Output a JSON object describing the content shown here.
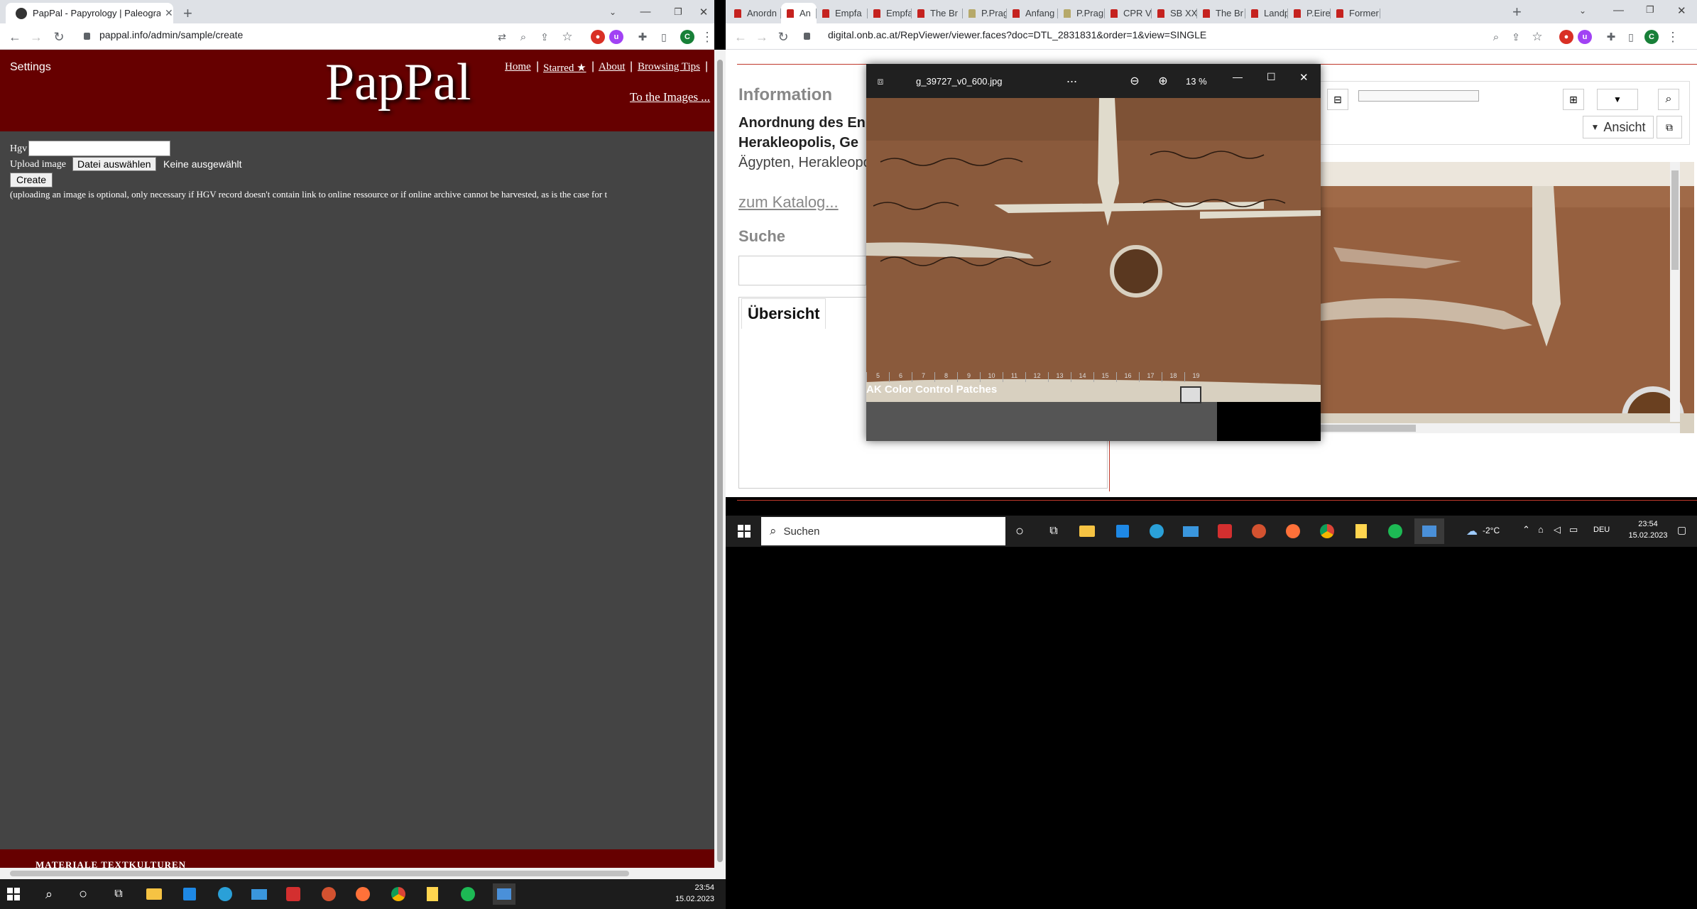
{
  "left_browser": {
    "tab_title": "PapPal - Papyrology | Paleograph",
    "url": "pappal.info/admin/sample/create",
    "profile_initial": "C",
    "site": {
      "settings_label": "Settings",
      "logo_text": "PapPal",
      "nav_links": [
        "Home",
        "Starred ★",
        "About",
        "Browsing Tips"
      ],
      "images_link": "To the Images ...",
      "hgv_label": "Hgv",
      "hgv_value": "",
      "upload_label": "Upload image",
      "file_button": "Datei auswählen",
      "no_file_text": "Keine ausgewählt",
      "create_button": "Create",
      "hint_text": "(uploading an image is optional, only necessary if HGV record doesn't contain link to online ressource or if online archive cannot be harvested, as is the case for t",
      "footer_text": "MATERIALE TEXTKULTUREN"
    }
  },
  "right_browser": {
    "tabs": [
      "Anordn",
      "An",
      "Empfa",
      "Empfa",
      "The Br",
      "P.Prag",
      "Anfang",
      "P.Prag",
      "CPR VI",
      "SB XXI",
      "The Br",
      "Landp",
      "P.Eiren",
      "Former"
    ],
    "url": "digital.onb.ac.at/RepViewer/viewer.faces?doc=DTL_2831831&order=1&view=SINGLE",
    "profile_initial": "C",
    "page": {
      "info_heading": "Information",
      "title_line1": "Anordnung des En",
      "title_line2": "Herakleopolis, Ge",
      "place_text": "Ägypten, Herakleopo",
      "catalog_link": "zum Katalog...",
      "search_heading": "Suche",
      "overview_tab": "Übersicht",
      "view_button": "Ansicht"
    },
    "photo_viewer": {
      "filename": "g_39727_v0_600.jpg",
      "more_label": "...",
      "zoom_level": "13 %",
      "ruler_numbers": [
        "5",
        "6",
        "7",
        "8",
        "9",
        "10",
        "11",
        "12",
        "13",
        "14",
        "15",
        "16",
        "17",
        "18",
        "19"
      ],
      "ruler_caption": "AK Color Control Patches"
    }
  },
  "taskbar_right": {
    "search_placeholder": "Suchen",
    "weather": "-2°C",
    "language": "DEU",
    "time": "23:54",
    "date": "15.02.2023"
  },
  "taskbar_left": {
    "time": "23:54",
    "date": "15.02.2023"
  },
  "colors": {
    "pappal_red": "#660000",
    "pappal_body": "#444444",
    "chrome_tabbar": "#dee1e6",
    "onb_red": "#c0392b",
    "papyrus": "#8a5a3c"
  }
}
